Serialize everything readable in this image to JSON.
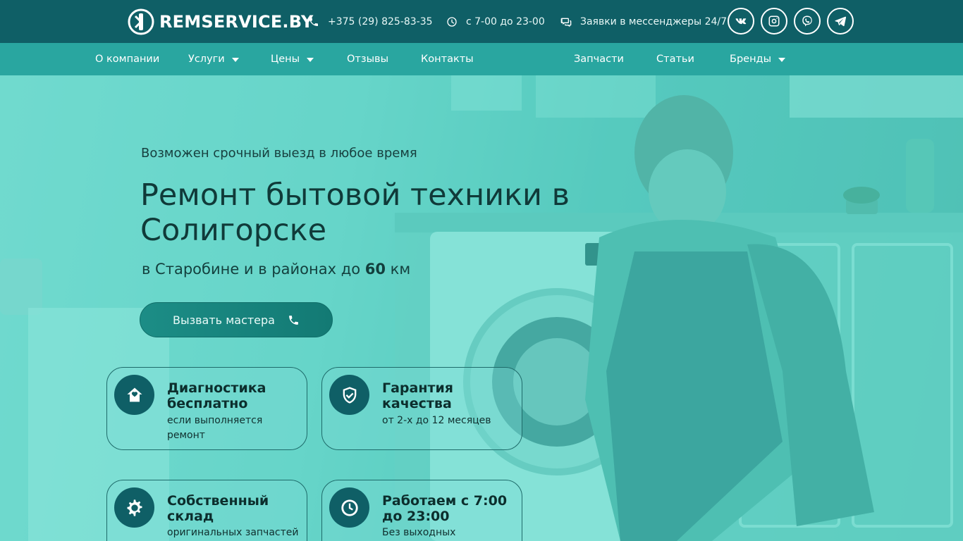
{
  "header": {
    "logo_text": "REMSERVICE.BY",
    "phone": "+375 (29) 825-83-35",
    "hours": "с 7-00 до 23-00",
    "messengers": "Заявки в мессенджеры 24/7",
    "social": [
      "vk",
      "instagram",
      "viber",
      "telegram"
    ]
  },
  "nav": {
    "items": [
      {
        "label": "О компании",
        "dropdown": false
      },
      {
        "label": "Услуги",
        "dropdown": true
      },
      {
        "label": "Цены",
        "dropdown": true
      },
      {
        "label": "Отзывы",
        "dropdown": false
      },
      {
        "label": "Контакты",
        "dropdown": false
      },
      {
        "label": "Запчасти",
        "dropdown": false
      },
      {
        "label": "Статьи",
        "dropdown": false
      },
      {
        "label": "Бренды",
        "dropdown": true
      }
    ]
  },
  "hero": {
    "kicker": "Возможен срочный выезд в любое время",
    "title": "Ремонт бытовой техники в Солигорске",
    "sub_prefix": "в Старобине и в районах до ",
    "sub_value": "60",
    "sub_suffix": " км",
    "cta_label": "Вызвать мастера"
  },
  "features": [
    {
      "title": "Диагностика бесплатно",
      "desc": "если выполняется ремонт",
      "icon": "home-icon"
    },
    {
      "title": "Гарантия качества",
      "desc": "от 2-х до 12 месяцев",
      "icon": "shield-check-icon"
    },
    {
      "title": "Собственный склад",
      "desc": "оригинальных запчастей",
      "icon": "gear-icon"
    },
    {
      "title": "Работаем с 7:00 до 23:00",
      "desc": "Без выходных",
      "icon": "clock-icon"
    }
  ],
  "colors": {
    "topbar": "#0f5f66",
    "nav": "#29a6a0",
    "accent": "#137a74"
  }
}
